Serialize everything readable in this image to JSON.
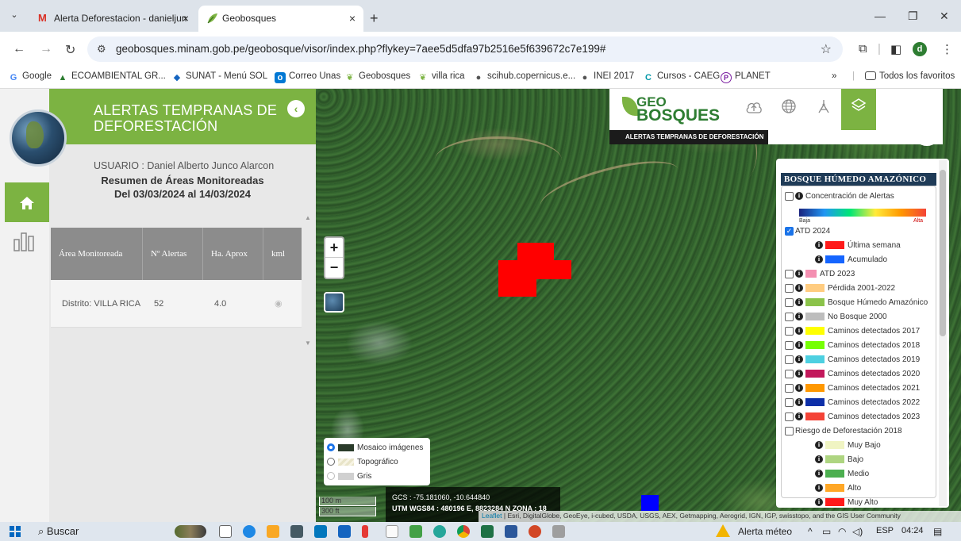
{
  "browser": {
    "tabs": [
      {
        "favicon": "M",
        "title": "Alerta Deforestacion - danieljun",
        "close": "×"
      },
      {
        "favicon": "leaf",
        "title": "Geobosques",
        "close": "×"
      }
    ],
    "new_tab": "+",
    "url": "geobosques.minam.gob.pe/geobosque/visor/index.php?flykey=7aee5d5dfa97b2516e5f639672c7e199#",
    "profile_initial": "d",
    "bookmarks": [
      {
        "label": "Google",
        "icon": "G",
        "color": "#4285f4"
      },
      {
        "label": "ECOAMBIENTAL GR...",
        "icon": "▲",
        "color": "#2e7d32"
      },
      {
        "label": "SUNAT - Menú SOL",
        "icon": "◆",
        "color": "#1565c0"
      },
      {
        "label": "Correo Unas",
        "icon": "o",
        "color": "#0078d4"
      },
      {
        "label": "Geobosques",
        "icon": "❦",
        "color": "#7cb342"
      },
      {
        "label": "villa rica",
        "icon": "❦",
        "color": "#7cb342"
      },
      {
        "label": "scihub.copernicus.e...",
        "icon": "●",
        "color": "#555"
      },
      {
        "label": "INEI 2017",
        "icon": "●",
        "color": "#555"
      },
      {
        "label": "Cursos - CAEG",
        "icon": "C",
        "color": "#0097a7"
      },
      {
        "label": "PLANET",
        "icon": "P",
        "color": "#7b1fa2"
      }
    ],
    "more_bookmarks": "»",
    "all_bookmarks": "Todos los favoritos"
  },
  "panel": {
    "title_line1": "ALERTAS TEMPRANAS DE",
    "title_line2": "DEFORESTACIÓN",
    "usuario": "USUARIO : Daniel Alberto Junco Alarcon",
    "resumen": "Resumen de Áreas Monitoreadas",
    "periodo": "Del 03/03/2024 al 14/03/2024",
    "table": {
      "headers": [
        "Área Monitoreada",
        "Nº Alertas",
        "Ha. Aprox",
        "kml"
      ],
      "rows": [
        {
          "area": "Distrito: VILLA RICA",
          "alertas": "52",
          "ha": "4.0"
        }
      ]
    }
  },
  "map": {
    "brand_top": "GEO",
    "brand_bottom": "BOSQUES",
    "subtitle": "ALERTAS TEMPRANAS DE DEFORESTACIÓN",
    "zoom_in": "+",
    "zoom_out": "−",
    "legend": {
      "title": "BOSQUE HÚMEDO AMAZÓNICO",
      "concentracion": "Concentración de Alertas",
      "baja": "Baja",
      "alta": "Alta",
      "atd2024": "ATD 2024",
      "ultima_semana": "Última semana",
      "acumulado": "Acumulado",
      "layers": [
        {
          "label": "ATD 2023",
          "color": "#f48fb1"
        },
        {
          "label": "Pérdida 2001-2022",
          "color": "#ffcc80"
        },
        {
          "label": "Bosque Húmedo Amazónico",
          "color": "#8bc34a"
        },
        {
          "label": "No Bosque 2000",
          "color": "#bdbdbd"
        },
        {
          "label": "Caminos detectados 2017",
          "color": "#ffff00"
        },
        {
          "label": "Caminos detectados 2018",
          "color": "#76ff03"
        },
        {
          "label": "Caminos detectados 2019",
          "color": "#4dd0e1"
        },
        {
          "label": "Caminos detectados 2020",
          "color": "#c2185b"
        },
        {
          "label": "Caminos detectados 2021",
          "color": "#ff9800"
        },
        {
          "label": "Caminos detectados 2022",
          "color": "#0d2fa8"
        },
        {
          "label": "Caminos detectados 2023",
          "color": "#f44336"
        }
      ],
      "riesgo_title": "Riesgo de Deforestación 2018",
      "riesgo": [
        {
          "label": "Muy Bajo",
          "color": "#f0f4c3"
        },
        {
          "label": "Bajo",
          "color": "#aed581"
        },
        {
          "label": "Medio",
          "color": "#4caf50"
        },
        {
          "label": "Alto",
          "color": "#ffa726"
        },
        {
          "label": "Muy Alto",
          "color": "#ff1a1a"
        }
      ]
    },
    "basemaps": [
      {
        "label": "Mosaico imágenes",
        "selected": true
      },
      {
        "label": "Topográfico",
        "selected": false
      },
      {
        "label": "Gris",
        "selected": false
      }
    ],
    "coords_gcs": "GCS : -75.181060, -10.644840",
    "coords_utm": "UTM WGS84 : 480196 E, 8823284 N ZONA : 18",
    "scale_m": "100 m",
    "scale_ft": "300 ft",
    "attribution_leaflet": "Leaflet",
    "attribution": "| Esri, DigitalGlobe, GeoEye, i-cubed, USDA, USGS, AEX, Getmapping, Aerogrid, IGN, IGP, swisstopo, and the GIS User Community"
  },
  "taskbar": {
    "search": "Buscar",
    "weather": "Alerta méteo",
    "lang": "ESP",
    "time": "04:24"
  }
}
